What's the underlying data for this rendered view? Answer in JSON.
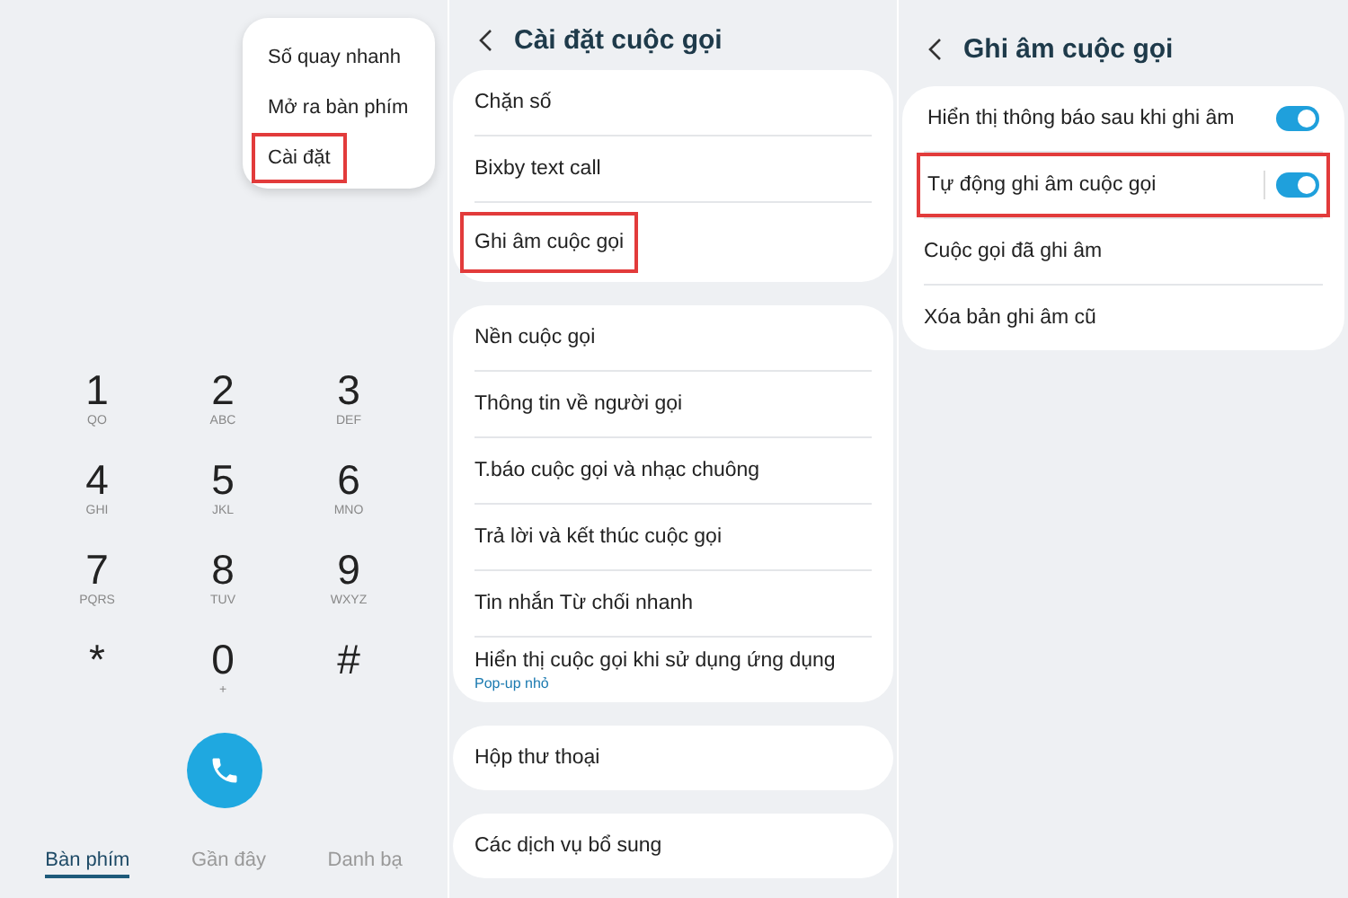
{
  "panels": [
    {
      "kind": "dialer",
      "menu": [
        {
          "label": "Số quay nhanh",
          "highlighted": false
        },
        {
          "label": "Mở ra bàn phím",
          "highlighted": false
        },
        {
          "label": "Cài đặt",
          "highlighted": true
        }
      ],
      "keys": [
        {
          "digit": "1",
          "letters": "QO"
        },
        {
          "digit": "2",
          "letters": "ABC"
        },
        {
          "digit": "3",
          "letters": "DEF"
        },
        {
          "digit": "4",
          "letters": "GHI"
        },
        {
          "digit": "5",
          "letters": "JKL"
        },
        {
          "digit": "6",
          "letters": "MNO"
        },
        {
          "digit": "7",
          "letters": "PQRS"
        },
        {
          "digit": "8",
          "letters": "TUV"
        },
        {
          "digit": "9",
          "letters": "WXYZ"
        },
        {
          "digit": "*"
        },
        {
          "digit": "0",
          "letters": "+"
        },
        {
          "digit": "#"
        }
      ],
      "tabs": [
        {
          "label": "Bàn phím",
          "selected": true
        },
        {
          "label": "Gần đây",
          "selected": false
        },
        {
          "label": "Danh bạ",
          "selected": false
        }
      ]
    },
    {
      "kind": "settings",
      "title": "Cài đặt cuộc gọi",
      "groups": [
        {
          "items": [
            {
              "kind": "link",
              "label": "Chặn số",
              "highlighted": false
            },
            {
              "kind": "link",
              "label": "Bixby text call",
              "highlighted": false
            },
            {
              "kind": "link",
              "label": "Ghi âm cuộc gọi",
              "highlighted": true
            }
          ]
        },
        {
          "items": [
            {
              "kind": "link",
              "label": "Nền cuộc gọi",
              "highlighted": false
            },
            {
              "kind": "link",
              "label": "Thông tin về người gọi",
              "highlighted": false
            },
            {
              "kind": "link",
              "label": "T.báo cuộc gọi và nhạc chuông",
              "highlighted": false
            },
            {
              "kind": "link",
              "label": "Trả lời và kết thúc cuộc gọi",
              "highlighted": false
            },
            {
              "kind": "link",
              "label": "Tin nhắn Từ chối nhanh",
              "highlighted": false
            },
            {
              "kind": "link",
              "label": "Hiển thị cuộc gọi khi sử dụng ứng dụng",
              "subtitle": "Pop-up nhỏ",
              "highlighted": false
            }
          ]
        },
        {
          "items": [
            {
              "kind": "link",
              "label": "Hộp thư thoại",
              "highlighted": false
            }
          ]
        },
        {
          "items": [
            {
              "kind": "link",
              "label": "Các dịch vụ bổ sung",
              "highlighted": false
            }
          ]
        }
      ]
    },
    {
      "kind": "settings",
      "title": "Ghi âm cuộc gọi",
      "groups": [
        {
          "items": [
            {
              "kind": "toggle",
              "label": "Hiển thị thông báo sau khi ghi âm",
              "on": true,
              "highlighted": false
            },
            {
              "kind": "toggle",
              "label": "Tự động ghi âm cuộc gọi",
              "on": true,
              "highlighted": true
            },
            {
              "kind": "link",
              "label": "Cuộc gọi đã ghi âm",
              "highlighted": false
            },
            {
              "kind": "link",
              "label": "Xóa bản ghi âm cũ",
              "highlighted": false
            }
          ]
        }
      ]
    }
  ]
}
